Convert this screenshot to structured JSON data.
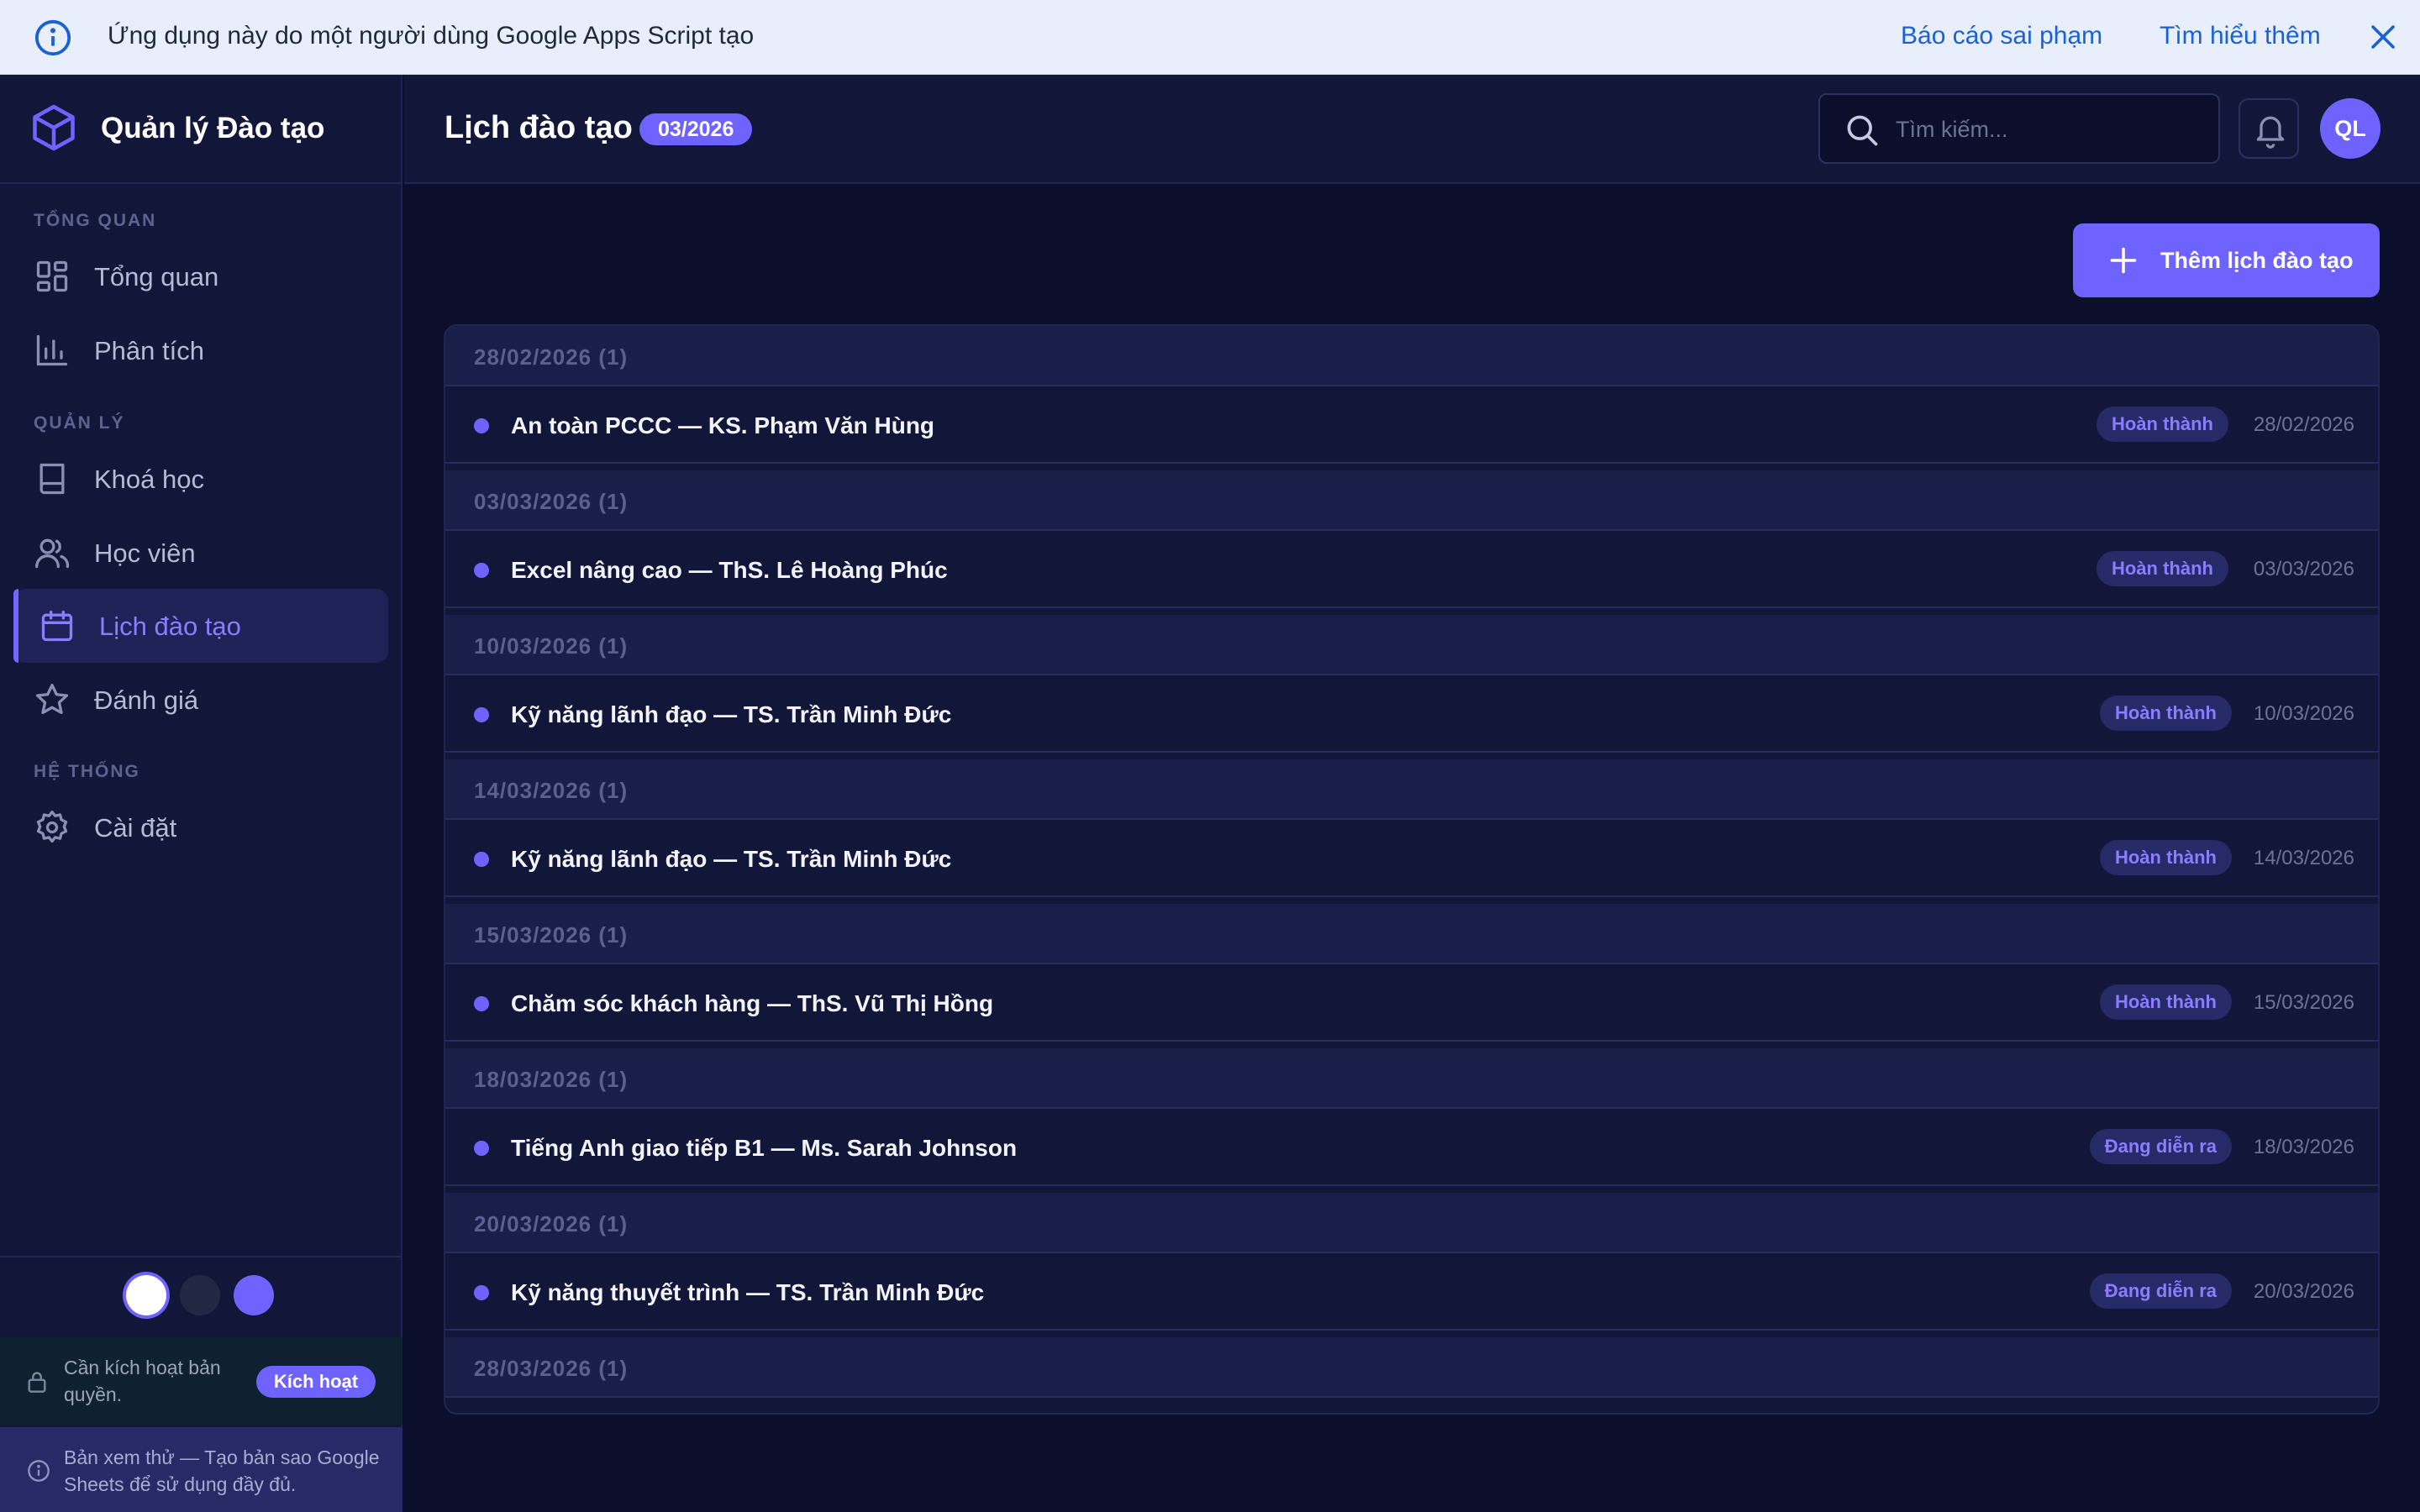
{
  "banner": {
    "message": "Ứng dụng này do một người dùng Google Apps Script tạo",
    "report_link": "Báo cáo sai phạm",
    "learn_link": "Tìm hiểu thêm"
  },
  "app": {
    "brand_name": "Quản lý Đào tạo"
  },
  "sidebar": {
    "sections": {
      "overview": "TỔNG QUAN",
      "management": "QUẢN LÝ",
      "system": "HỆ THỐNG"
    },
    "items": [
      {
        "label": "Tổng quan",
        "icon": "dashboard-icon"
      },
      {
        "label": "Phân tích",
        "icon": "bar-chart-icon"
      },
      {
        "label": "Khoá học",
        "icon": "book-icon"
      },
      {
        "label": "Học viên",
        "icon": "users-icon"
      },
      {
        "label": "Lịch đào tạo",
        "icon": "calendar-icon",
        "active": true
      },
      {
        "label": "Đánh giá",
        "icon": "star-icon"
      },
      {
        "label": "Cài đặt",
        "icon": "gear-icon"
      }
    ],
    "license": {
      "text": "Cần kích hoạt bản quyền.",
      "button": "Kích hoạt"
    },
    "preview_text": "Bản xem thử — Tạo bản sao Google Sheets để sử dụng đầy đủ."
  },
  "header": {
    "title": "Lịch đào tạo",
    "month_badge": "03/2026",
    "search_placeholder": "Tìm kiếm...",
    "avatar_initials": "QL"
  },
  "main": {
    "add_button": "Thêm lịch đào tạo",
    "groups": [
      {
        "header": "28/02/2026 (1)",
        "title": "An toàn PCCC — KS. Phạm Văn Hùng",
        "status": "Hoàn thành",
        "date": "28/02/2026"
      },
      {
        "header": "03/03/2026 (1)",
        "title": "Excel nâng cao — ThS. Lê Hoàng Phúc",
        "status": "Hoàn thành",
        "date": "03/03/2026"
      },
      {
        "header": "10/03/2026 (1)",
        "title": "Kỹ năng lãnh đạo — TS. Trần Minh Đức",
        "status": "Hoàn thành",
        "date": "10/03/2026"
      },
      {
        "header": "14/03/2026 (1)",
        "title": "Kỹ năng lãnh đạo — TS. Trần Minh Đức",
        "status": "Hoàn thành",
        "date": "14/03/2026"
      },
      {
        "header": "15/03/2026 (1)",
        "title": "Chăm sóc khách hàng — ThS. Vũ Thị Hồng",
        "status": "Hoàn thành",
        "date": "15/03/2026"
      },
      {
        "header": "18/03/2026 (1)",
        "title": "Tiếng Anh giao tiếp B1 — Ms. Sarah Johnson",
        "status": "Đang diễn ra",
        "date": "18/03/2026"
      },
      {
        "header": "20/03/2026 (1)",
        "title": "Kỹ năng thuyết trình — TS. Trần Minh Đức",
        "status": "Đang diễn ra",
        "date": "20/03/2026"
      },
      {
        "header": "28/03/2026 (1)"
      }
    ]
  },
  "colors": {
    "accent": "#6f63ff",
    "background": "#0b0f2b",
    "panel": "#121739",
    "banner_bg": "#e8eefb",
    "banner_link": "#1a62d4"
  }
}
